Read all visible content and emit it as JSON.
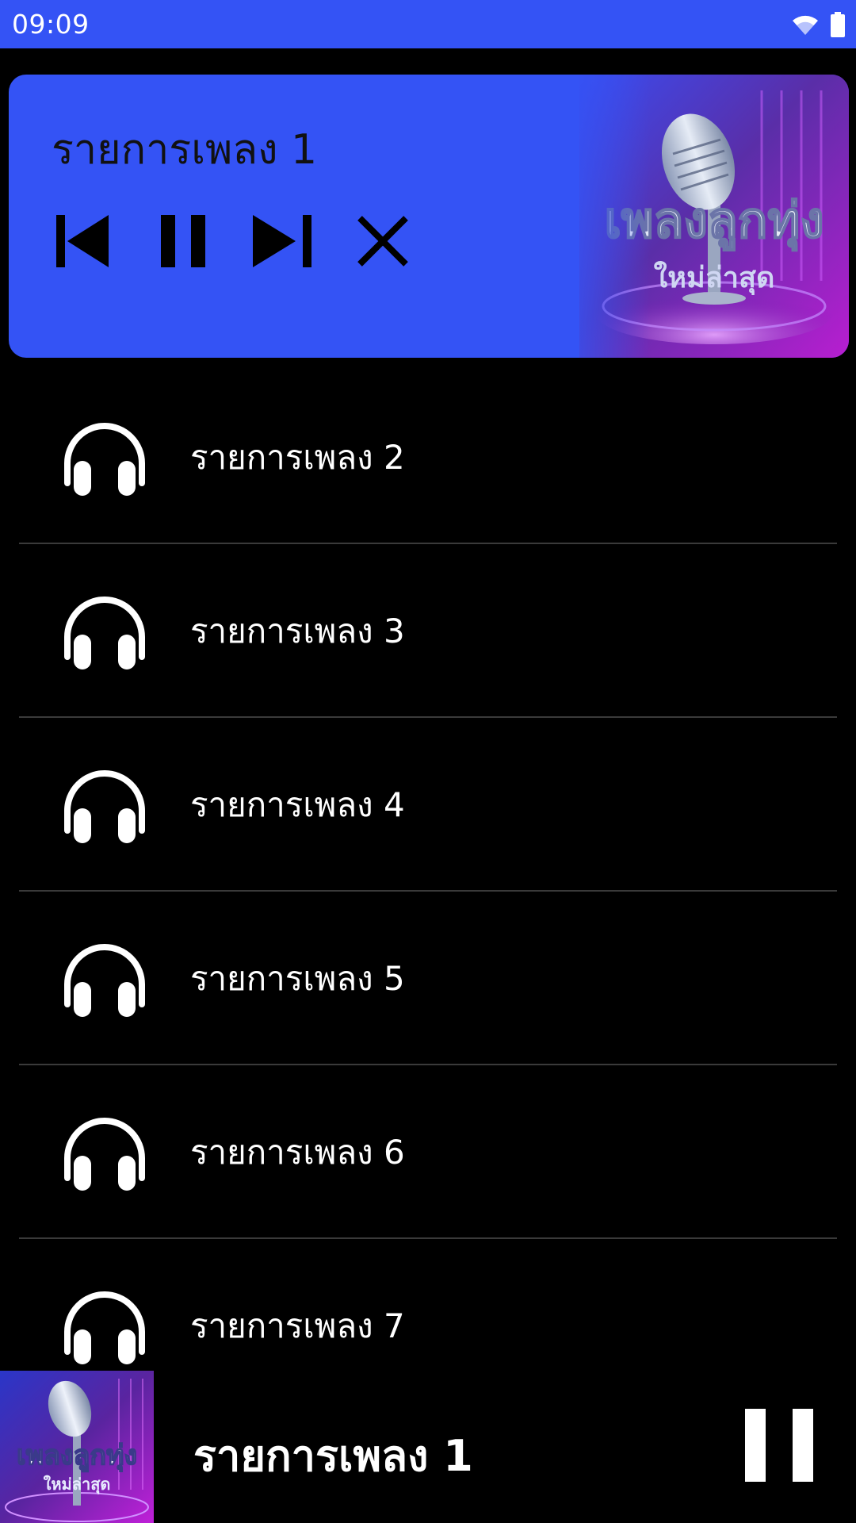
{
  "status_bar": {
    "time": "09:09",
    "icons": [
      "wifi-icon",
      "battery-icon"
    ],
    "background": "#3453f5"
  },
  "now_playing_card": {
    "title": "รายการเพลง 1",
    "controls": [
      "previous-icon",
      "pause-icon",
      "next-icon",
      "close-icon"
    ],
    "artwork": {
      "headline": "เพลงลูกทุ่ง",
      "subline": "ใหม่ล่าสุด"
    },
    "accent": "#3453f5"
  },
  "playlist": {
    "items": [
      {
        "label": "รายการเพลง 2",
        "icon": "headphones-icon"
      },
      {
        "label": "รายการเพลง 3",
        "icon": "headphones-icon"
      },
      {
        "label": "รายการเพลง 4",
        "icon": "headphones-icon"
      },
      {
        "label": "รายการเพลง 5",
        "icon": "headphones-icon"
      },
      {
        "label": "รายการเพลง 6",
        "icon": "headphones-icon"
      },
      {
        "label": "รายการเพลง 7",
        "icon": "headphones-icon"
      }
    ]
  },
  "mini_player": {
    "title": "รายการเพลง 1",
    "artwork": {
      "headline": "เพลงลูกทุ่ง",
      "subline": "ใหม่ล่าสุด"
    },
    "control": "pause-icon"
  }
}
